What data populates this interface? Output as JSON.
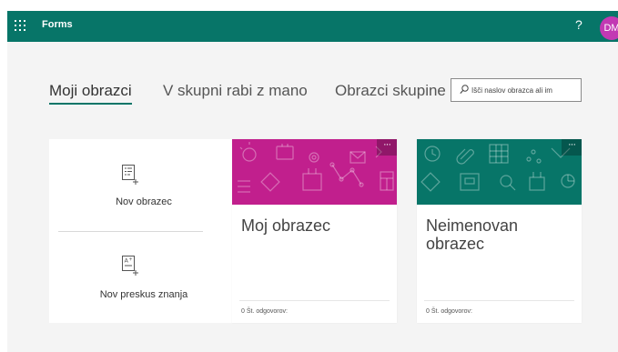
{
  "header": {
    "app_name": "Forms",
    "help": "?",
    "avatar_initials": "DM",
    "color": "#077568",
    "avatar_color": "#c239b3"
  },
  "tabs": [
    {
      "label": "Moji obrazci",
      "active": true
    },
    {
      "label": "V skupni rabi z mano",
      "active": false
    },
    {
      "label": "Obrazci skupine",
      "active": false
    }
  ],
  "search": {
    "placeholder": "Išči naslov obrazca ali im",
    "icon": "search-icon"
  },
  "new_panel": {
    "new_form_label": "Nov obrazec",
    "new_form_icon": "new-form-icon",
    "new_quiz_label": "Nov preskus znanja",
    "new_quiz_icon": "new-quiz-icon"
  },
  "cards": [
    {
      "title": "Moj obrazec",
      "footer": "0 Št. odgovorov:",
      "banner_color": "#c11f8d",
      "more": "···"
    },
    {
      "title": "Neimenovan obrazec",
      "footer": "0 Št. odgovorov:",
      "banner_color": "#077568",
      "more": "···"
    }
  ]
}
